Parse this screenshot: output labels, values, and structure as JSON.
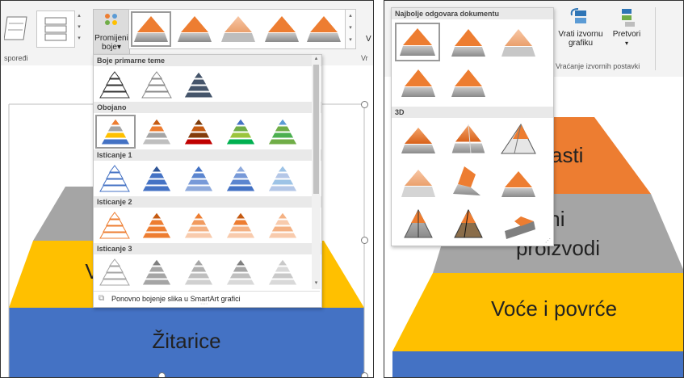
{
  "left": {
    "ribbon": {
      "group_label_layouts": "spoređi",
      "group_label_right": "Vr",
      "change_colors_line1": "Promijeni",
      "change_colors_line2": "boje",
      "change_colors_arrow": "▾",
      "right_cut_text": "V"
    },
    "dropdown": {
      "sections": [
        {
          "title": "Boje primarne teme"
        },
        {
          "title": "Obojano"
        },
        {
          "title": "Isticanje 1"
        },
        {
          "title": "Isticanje 2"
        },
        {
          "title": "Isticanje 3"
        }
      ],
      "footer_label": "Ponovno bojenje slika u SmartArt grafici",
      "footer_icon": "recolor-pictures-icon"
    },
    "slide": {
      "tiers": [
        {
          "label": "V",
          "color": "#FFC000"
        },
        {
          "label": "Žitarice",
          "color": "#4472C4"
        }
      ],
      "gray_tier_color": "#A5A5A5"
    }
  },
  "right": {
    "dropdown": {
      "sections": [
        {
          "title": "Najbolje odgovara dokumentu"
        },
        {
          "title": "3D"
        }
      ]
    },
    "ribbon": {
      "reset_line1": "Vrati izvornu",
      "reset_line2": "grafiku",
      "convert_label": "Pretvori",
      "convert_arrow": "▾",
      "group_label": "Vraćanje izvornih postavki"
    },
    "slide": {
      "tiers": [
        {
          "label": "asti",
          "color": "#ED7D31"
        },
        {
          "label_line1": "lečni",
          "label_line2": "proizvodi",
          "color": "#A5A5A5"
        },
        {
          "label": "Voće i povrće",
          "color": "#FFC000"
        },
        {
          "label": "Žitarice",
          "color": "#4472C4"
        }
      ]
    }
  },
  "colors": {
    "accent_orange": "#ED7D31",
    "accent_gray": "#A5A5A5",
    "accent_yellow": "#FFC000",
    "accent_blue": "#4472C4",
    "accent_green": "#70AD47",
    "dark_navy": "#44546A"
  }
}
